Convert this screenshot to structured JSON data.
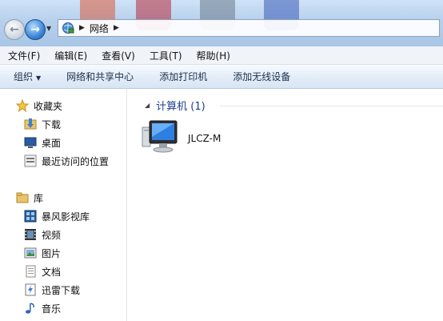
{
  "address": {
    "location": "网络",
    "icon": "network-icon"
  },
  "menu": [
    "文件(F)",
    "编辑(E)",
    "查看(V)",
    "工具(T)",
    "帮助(H)"
  ],
  "toolbar": {
    "organize": "组织",
    "network_center": "网络和共享中心",
    "add_printer": "添加打印机",
    "add_wireless": "添加无线设备"
  },
  "nav": {
    "favorites": {
      "label": "收藏夹",
      "items": [
        {
          "label": "下载",
          "icon": "download-folder-icon"
        },
        {
          "label": "桌面",
          "icon": "desktop-icon"
        },
        {
          "label": "最近访问的位置",
          "icon": "recent-places-icon"
        }
      ]
    },
    "libraries": {
      "label": "库",
      "items": [
        {
          "label": "暴风影视库",
          "icon": "video-library-icon"
        },
        {
          "label": "视频",
          "icon": "video-icon"
        },
        {
          "label": "图片",
          "icon": "pictures-icon"
        },
        {
          "label": "文档",
          "icon": "documents-icon"
        },
        {
          "label": "迅雷下载",
          "icon": "thunder-download-icon"
        },
        {
          "label": "音乐",
          "icon": "music-icon"
        }
      ]
    }
  },
  "content": {
    "group_title": "计算机 (1)",
    "computers": [
      {
        "name": "JLCZ-M",
        "icon": "computer-icon"
      }
    ]
  },
  "colors": {
    "group_title": "#1e3e8f",
    "toolbar_text": "#1b2f4e"
  }
}
